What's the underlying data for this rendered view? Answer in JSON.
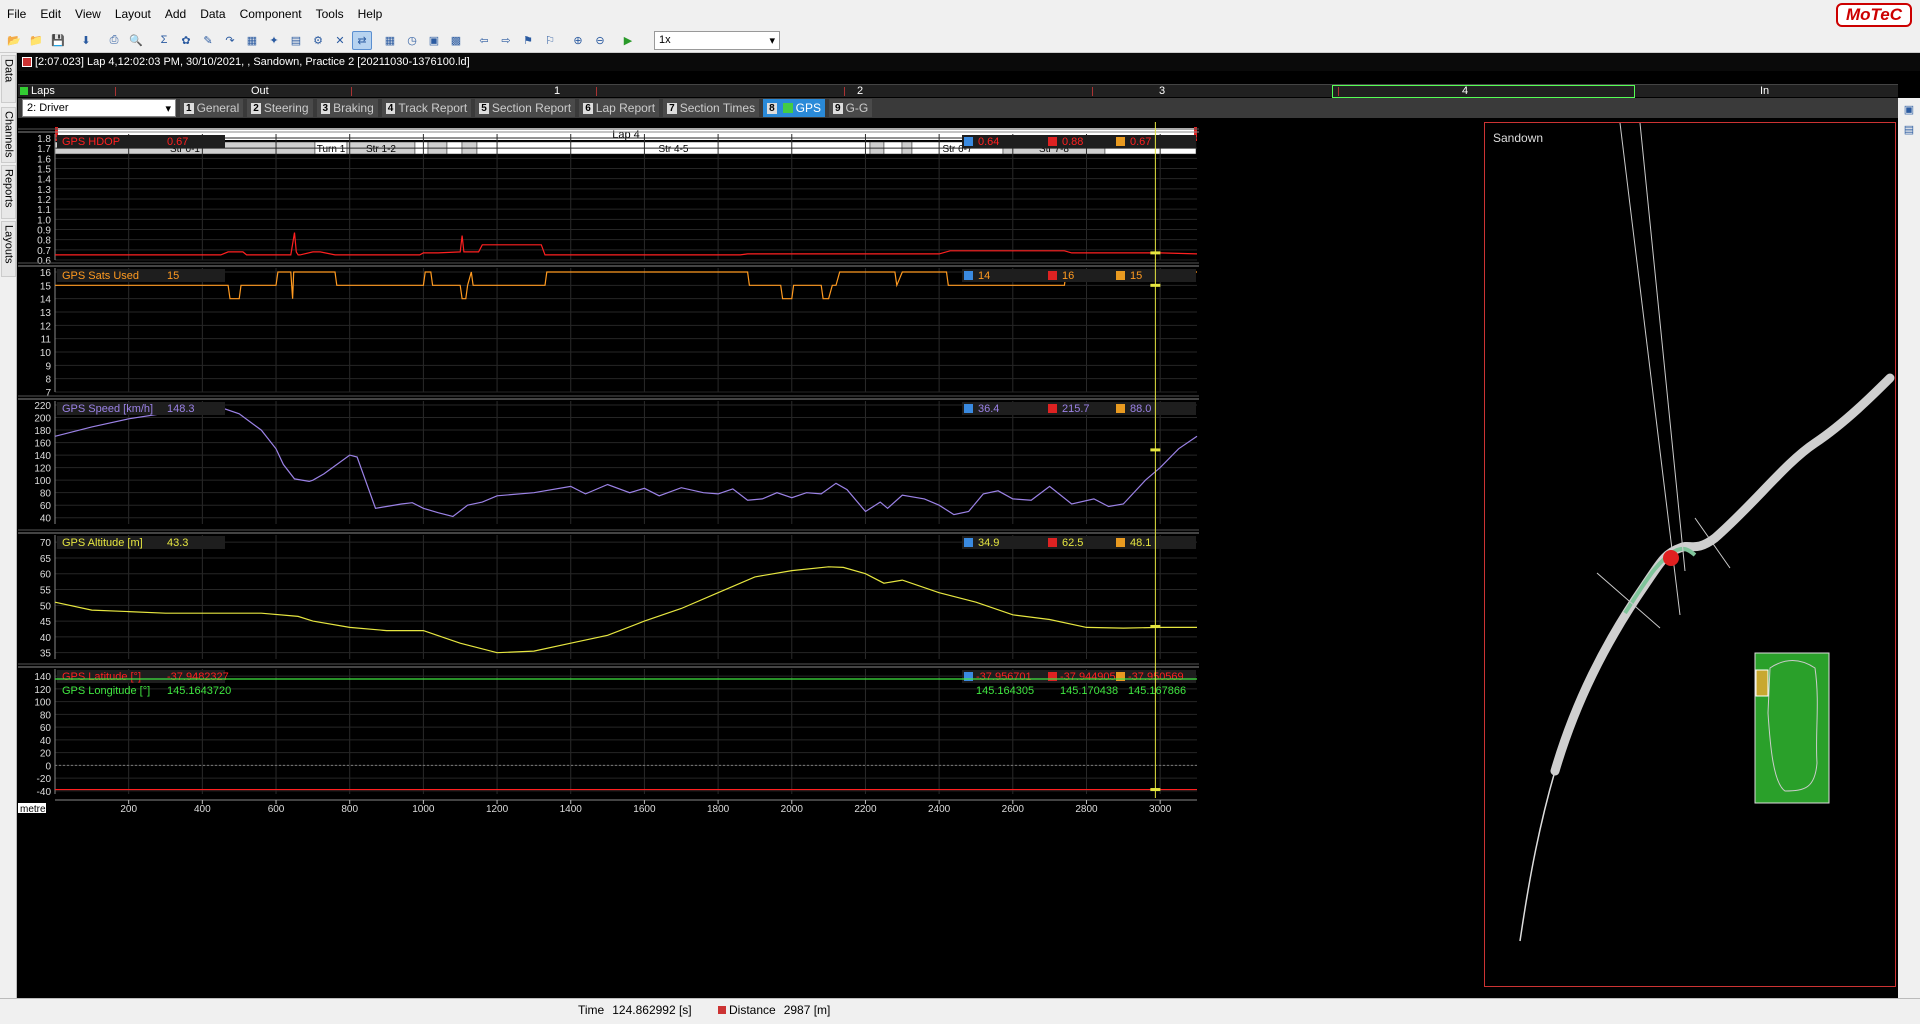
{
  "menu": {
    "items": [
      "File",
      "Edit",
      "View",
      "Layout",
      "Add",
      "Data",
      "Component",
      "Tools",
      "Help"
    ],
    "brand": "MoTeC"
  },
  "toolbar": {
    "zoom_value": "1x"
  },
  "document": {
    "title": "[2:07.023] Lap 4,12:02:03 PM, 30/10/2021, , Sandown, Practice 2 [20211030-1376100.ld]"
  },
  "left_tabs": [
    "Data",
    "Channels",
    "Reports",
    "Layouts"
  ],
  "laps_bar": {
    "label": "Laps",
    "laps": [
      "Out",
      "1",
      "2",
      "3",
      "4",
      "In"
    ],
    "current": "4"
  },
  "driver_select": "2: Driver",
  "worksheet_tabs": [
    {
      "num": "1",
      "label": "General"
    },
    {
      "num": "2",
      "label": "Steering"
    },
    {
      "num": "3",
      "label": "Braking"
    },
    {
      "num": "4",
      "label": "Track Report"
    },
    {
      "num": "5",
      "label": "Section Report"
    },
    {
      "num": "6",
      "label": "Lap Report"
    },
    {
      "num": "7",
      "label": "Section Times"
    },
    {
      "num": "8",
      "label": "GPS",
      "active": true
    },
    {
      "num": "9",
      "label": "G-G"
    }
  ],
  "lap_header": "Lap 4",
  "sections": [
    {
      "name": "Str 0-1",
      "from": 55,
      "to": 315,
      "white": false
    },
    {
      "name": "Turn 1",
      "from": 315,
      "to": 347,
      "white": true
    },
    {
      "name": "Str 1-2",
      "from": 347,
      "to": 415,
      "white": false
    },
    {
      "name": "",
      "from": 415,
      "to": 428,
      "white": true
    },
    {
      "name": "",
      "from": 428,
      "to": 447,
      "white": false
    },
    {
      "name": "",
      "from": 447,
      "to": 462,
      "white": true
    },
    {
      "name": "",
      "from": 462,
      "to": 477,
      "white": false
    },
    {
      "name": "Str 4-5",
      "from": 477,
      "to": 870,
      "white": true
    },
    {
      "name": "",
      "from": 870,
      "to": 884,
      "white": false
    },
    {
      "name": "",
      "from": 884,
      "to": 902,
      "white": true
    },
    {
      "name": "",
      "from": 902,
      "to": 912,
      "white": false
    },
    {
      "name": "Str 6-7",
      "from": 912,
      "to": 1003,
      "white": true
    },
    {
      "name": "Str 7-8",
      "from": 1003,
      "to": 1105,
      "white": false
    },
    {
      "name": "",
      "from": 1105,
      "to": 1196,
      "white": true
    }
  ],
  "colors": {
    "hdop": "#ff2020",
    "sats": "#ff9a20",
    "speed": "#9b82e6",
    "altitude": "#e6e640",
    "latitude": "#ff2020",
    "longitude": "#40e640",
    "cursor": "#e6e640",
    "track_map_bg": "#2aa02a"
  },
  "chart_data": [
    {
      "type": "line",
      "channel": "GPS HDOP",
      "cursor_value": "0.67",
      "min": "0.64",
      "max": "0.88",
      "avg": "0.67",
      "ylim": [
        0.6,
        1.8
      ],
      "yticks": [
        "1.8",
        "1.7",
        "1.6",
        "1.5",
        "1.4",
        "1.3",
        "1.2",
        "1.1",
        "1.0",
        "0.9",
        "0.8",
        "0.7",
        "0.6"
      ],
      "x": [
        0,
        450,
        470,
        510,
        520,
        640,
        650,
        655,
        660,
        665,
        700,
        720,
        760,
        990,
        1000,
        1040,
        1100,
        1105,
        1110,
        1150,
        1160,
        1320,
        1330,
        1860,
        1880,
        2400,
        2430,
        2740,
        2760,
        3000,
        3100
      ],
      "y": [
        0.65,
        0.65,
        0.68,
        0.68,
        0.65,
        0.65,
        0.87,
        0.68,
        0.65,
        0.65,
        0.68,
        0.68,
        0.65,
        0.65,
        0.67,
        0.67,
        0.68,
        0.84,
        0.68,
        0.68,
        0.75,
        0.75,
        0.65,
        0.65,
        0.66,
        0.66,
        0.69,
        0.69,
        0.67,
        0.67,
        0.66
      ]
    },
    {
      "type": "line",
      "channel": "GPS Sats Used",
      "cursor_value": "15",
      "min": "14",
      "max": "16",
      "avg": "15",
      "ylim": [
        7,
        16
      ],
      "yticks": [
        "16",
        "15",
        "14",
        "13",
        "12",
        "11",
        "10",
        "9",
        "8",
        "7"
      ],
      "x": [
        0,
        470,
        475,
        500,
        505,
        600,
        605,
        640,
        645,
        648,
        655,
        670,
        760,
        765,
        1000,
        1005,
        1020,
        1025,
        1100,
        1105,
        1115,
        1120,
        1130,
        1135,
        1330,
        1335,
        1880,
        1885,
        1970,
        1975,
        2000,
        2005,
        2080,
        2085,
        2100,
        2110,
        2120,
        2130,
        2280,
        2285,
        2300,
        2420,
        2425,
        2740,
        2745,
        3100
      ],
      "y": [
        15,
        15,
        14,
        14,
        15,
        15,
        16,
        16,
        14,
        16,
        16,
        16,
        16,
        15,
        15,
        16,
        16,
        15,
        15,
        14,
        14,
        15,
        16,
        15,
        15,
        16,
        16,
        15,
        15,
        14,
        14,
        15,
        15,
        14,
        14,
        15,
        15,
        16,
        16,
        15,
        16,
        16,
        15,
        15,
        16,
        16
      ]
    },
    {
      "type": "line",
      "channel": "GPS Speed [km/h]",
      "cursor_value": "148.3",
      "min": "36.4",
      "max": "215.7",
      "avg": "88.0",
      "ylim": [
        30,
        220
      ],
      "yticks": [
        "220",
        "200",
        "180",
        "160",
        "140",
        "120",
        "100",
        "80",
        "60",
        "40"
      ],
      "x": [
        0,
        100,
        200,
        300,
        400,
        450,
        500,
        560,
        600,
        620,
        650,
        690,
        700,
        730,
        800,
        820,
        870,
        900,
        940,
        970,
        1000,
        1040,
        1080,
        1120,
        1160,
        1200,
        1300,
        1400,
        1440,
        1500,
        1560,
        1600,
        1640,
        1700,
        1760,
        1800,
        1840,
        1880,
        1920,
        1960,
        2000,
        2040,
        2080,
        2120,
        2150,
        2200,
        2240,
        2260,
        2300,
        2360,
        2400,
        2440,
        2480,
        2520,
        2560,
        2600,
        2650,
        2700,
        2760,
        2820,
        2860,
        2900,
        2960,
        3000,
        3050,
        3100
      ],
      "y": [
        170,
        185,
        198,
        207,
        213,
        216,
        206,
        180,
        150,
        125,
        102,
        98,
        100,
        110,
        140,
        137,
        55,
        58,
        62,
        64,
        55,
        48,
        42,
        60,
        65,
        75,
        80,
        90,
        78,
        93,
        80,
        87,
        75,
        88,
        80,
        78,
        86,
        68,
        70,
        80,
        72,
        80,
        78,
        95,
        85,
        50,
        65,
        55,
        76,
        70,
        60,
        45,
        50,
        78,
        83,
        70,
        68,
        90,
        62,
        70,
        58,
        62,
        100,
        120,
        150,
        170
      ]
    },
    {
      "type": "line",
      "channel": "GPS Altitude [m]",
      "cursor_value": "43.3",
      "min": "34.9",
      "max": "62.5",
      "avg": "48.1",
      "ylim": [
        33,
        71
      ],
      "yticks": [
        "70",
        "65",
        "60",
        "55",
        "50",
        "45",
        "40",
        "35"
      ],
      "x": [
        0,
        100,
        200,
        300,
        400,
        500,
        560,
        660,
        700,
        800,
        900,
        1000,
        1100,
        1200,
        1300,
        1400,
        1500,
        1600,
        1700,
        1800,
        1900,
        2000,
        2100,
        2140,
        2200,
        2250,
        2300,
        2400,
        2500,
        2600,
        2700,
        2800,
        2900,
        3000,
        3100
      ],
      "y": [
        51,
        48.5,
        48,
        47.5,
        47.5,
        47.5,
        47.5,
        46.5,
        45,
        43,
        42,
        42,
        38,
        35,
        35.5,
        38,
        40.5,
        45,
        49,
        54,
        59,
        61,
        62.2,
        62,
        60,
        57,
        58,
        54,
        51,
        47,
        45.5,
        43,
        42.8,
        43,
        43
      ]
    },
    {
      "type": "line",
      "channel_latitude": "GPS Latitude [°]",
      "latitude_value": "-37.9482327",
      "latitude_stats": [
        "-37.956701",
        "-37.944905",
        "-37.950569"
      ],
      "channel_longitude": "GPS Longitude [°]",
      "longitude_value": "145.1643720",
      "longitude_stats": [
        "145.164305",
        "145.170438",
        "145.167866"
      ],
      "ylim": [
        -45,
        145
      ],
      "yticks": [
        "140",
        "120",
        "100",
        "80",
        "60",
        "40",
        "20",
        "0",
        "-20",
        "-40"
      ]
    }
  ],
  "x_axis": {
    "unit": "metre",
    "ticks": [
      "200",
      "400",
      "600",
      "800",
      "1000",
      "1200",
      "1400",
      "1600",
      "1800",
      "2000",
      "2200",
      "2400",
      "2600",
      "2800",
      "3000"
    ],
    "cursor_distance": 2987
  },
  "map": {
    "title": "Sandown"
  },
  "status": {
    "time_label": "Time",
    "time_value": "124.862992 [s]",
    "distance_label": "Distance",
    "distance_value": "2987 [m]"
  }
}
